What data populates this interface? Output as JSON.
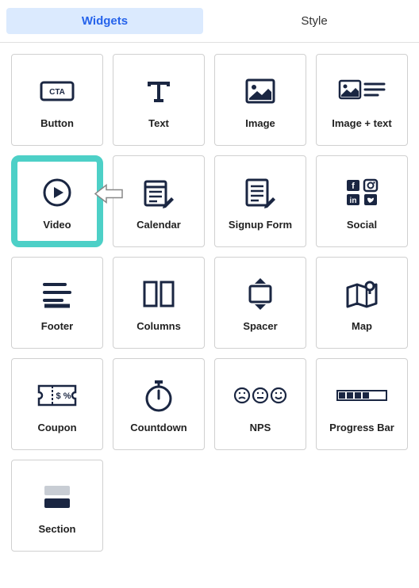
{
  "tabs": {
    "widgets": "Widgets",
    "style": "Style"
  },
  "widgets": [
    {
      "key": "button",
      "label": "Button"
    },
    {
      "key": "text",
      "label": "Text"
    },
    {
      "key": "image",
      "label": "Image"
    },
    {
      "key": "image-text",
      "label": "Image + text"
    },
    {
      "key": "video",
      "label": "Video"
    },
    {
      "key": "calendar",
      "label": "Calendar"
    },
    {
      "key": "signup-form",
      "label": "Signup Form"
    },
    {
      "key": "social",
      "label": "Social"
    },
    {
      "key": "footer",
      "label": "Footer"
    },
    {
      "key": "columns",
      "label": "Columns"
    },
    {
      "key": "spacer",
      "label": "Spacer"
    },
    {
      "key": "map",
      "label": "Map"
    },
    {
      "key": "coupon",
      "label": "Coupon"
    },
    {
      "key": "countdown",
      "label": "Countdown"
    },
    {
      "key": "nps",
      "label": "NPS"
    },
    {
      "key": "progress-bar",
      "label": "Progress Bar"
    },
    {
      "key": "section",
      "label": "Section"
    }
  ],
  "highlighted_widget": "video"
}
